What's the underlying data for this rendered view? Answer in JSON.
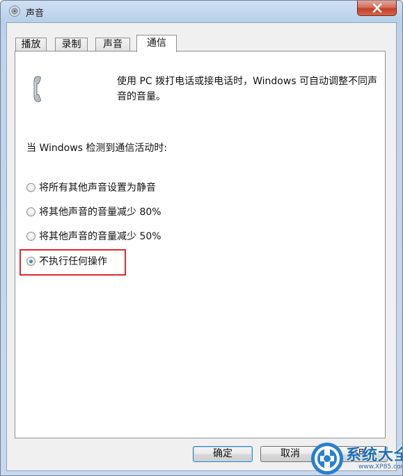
{
  "window": {
    "title": "声音",
    "close_icon": "close-icon"
  },
  "tabs": [
    {
      "label": "播放",
      "active": false
    },
    {
      "label": "录制",
      "active": false
    },
    {
      "label": "声音",
      "active": false
    },
    {
      "label": "通信",
      "active": true
    }
  ],
  "panel": {
    "description": "使用 PC 拨打电话或接电话时，Windows 可自动调整不同声音的音量。",
    "section_label": "当 Windows 检测到通信活动时:",
    "options": [
      {
        "label": "将所有其他声音设置为静音",
        "checked": false
      },
      {
        "label": "将其他声音的音量减少 80%",
        "checked": false
      },
      {
        "label": "将其他声音的音量减少 50%",
        "checked": false
      },
      {
        "label": "不执行任何操作",
        "checked": true
      }
    ],
    "highlight_color": "#e0262b"
  },
  "buttons": {
    "ok": "确定",
    "cancel": "取消",
    "apply": "应用"
  },
  "watermark": {
    "text": "系统大全",
    "url": "www.XP85.com"
  }
}
